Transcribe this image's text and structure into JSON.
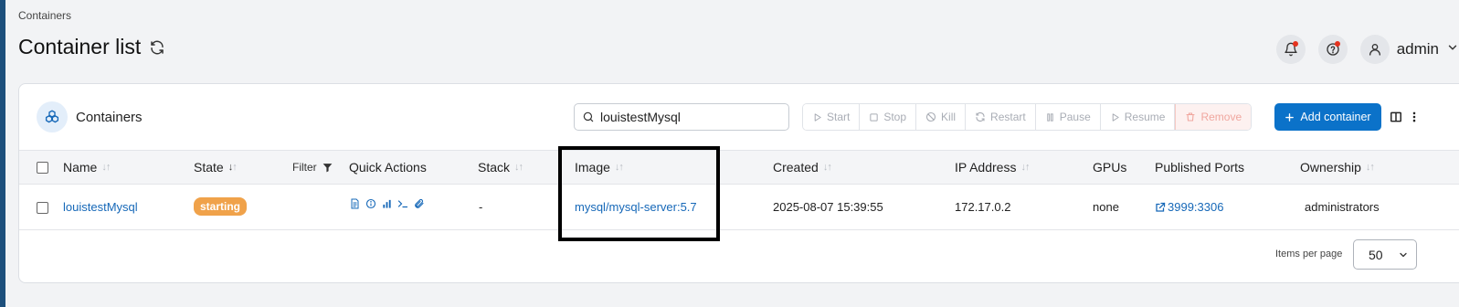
{
  "breadcrumb": "Containers",
  "page_title": "Container list",
  "header": {
    "username": "admin"
  },
  "card": {
    "title": "Containers",
    "search": {
      "value": "louistestMysql",
      "placeholder": "Search..."
    },
    "actions": [
      "Start",
      "Stop",
      "Kill",
      "Restart",
      "Pause",
      "Resume",
      "Remove"
    ],
    "add_button": "Add container"
  },
  "table": {
    "columns": {
      "name": "Name",
      "state": "State",
      "filter": "Filter",
      "quick_actions": "Quick Actions",
      "stack": "Stack",
      "image": "Image",
      "created": "Created",
      "ip": "IP Address",
      "gpus": "GPUs",
      "ports": "Published Ports",
      "ownership": "Ownership"
    },
    "rows": [
      {
        "name": "louistestMysql",
        "state": "starting",
        "stack": "-",
        "image": "mysql/mysql-server:5.7",
        "created": "2025-08-07 15:39:55",
        "ip": "172.17.0.2",
        "gpus": "none",
        "ports": "3999:3306",
        "ownership": "administrators"
      }
    ]
  },
  "pagination": {
    "label": "Items per page",
    "value": "50"
  },
  "colors": {
    "accent": "#0b72c9",
    "badge_starting": "#f0a24a",
    "link": "#1668b8",
    "remove": "#f0a79f"
  }
}
